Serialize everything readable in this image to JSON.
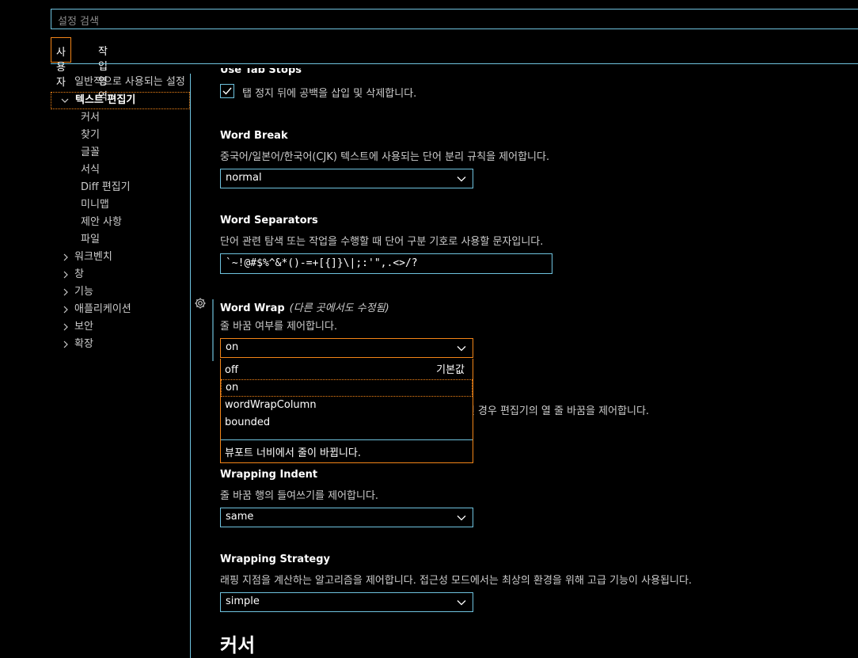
{
  "search": {
    "placeholder": "설정 검색"
  },
  "scope_tabs": {
    "user": "사용자",
    "workspace": "작업 영역"
  },
  "toc": {
    "general": "일반적으로 사용되는 설정",
    "text_editor": "텍스트 편집기",
    "editor_children": [
      "커서",
      "찾기",
      "글꼴",
      "서식",
      "Diff 편집기",
      "미니맵",
      "제안 사항",
      "파일"
    ],
    "groups": [
      "워크벤치",
      "창",
      "기능",
      "애플리케이션",
      "보안",
      "확장"
    ]
  },
  "settings": {
    "use_tab_stops": {
      "title": "Use Tab Stops",
      "checkbox_label": "탭 정지 뒤에 공백을 삽입 및 삭제합니다.",
      "checked": true
    },
    "word_break": {
      "title": "Word Break",
      "desc": "중국어/일본어/한국어(CJK) 텍스트에 사용되는 단어 분리 규칙을 제어합니다.",
      "value": "normal"
    },
    "word_separators": {
      "title": "Word Separators",
      "desc": "단어 관련 탐색 또는 작업을 수행할 때 단어 구분 기호로 사용할 문자입니다.",
      "value": "`~!@#$%^&*()-=+[{]}\\|;:'\",.<>/?"
    },
    "word_wrap": {
      "title": "Word Wrap",
      "modified_note": "(다른 곳에서도 수정됨)",
      "desc": "줄 바꿈 여부를 제어합니다.",
      "value": "on",
      "options": [
        {
          "label": "off",
          "tag": "기본값"
        },
        {
          "label": "on",
          "tag": ""
        },
        {
          "label": "wordWrapColumn",
          "tag": ""
        },
        {
          "label": "bounded",
          "tag": ""
        }
      ],
      "option_desc": "뷰포트 너비에서 줄이 바뀝니다."
    },
    "word_wrap_column_partial": "n'인 경우 편집기의 열 줄 바꿈을 제어합니다.",
    "wrapping_indent": {
      "title": "Wrapping Indent",
      "desc": "줄 바꿈 행의 들여쓰기를 제어합니다.",
      "value": "same"
    },
    "wrapping_strategy": {
      "title": "Wrapping Strategy",
      "desc": "래핑 지점을 계산하는 알고리즘을 제어합니다. 접근성 모드에서는 최상의 환경을 위해 고급 기능이 사용됩니다.",
      "value": "simple"
    }
  },
  "section_heading": "커서",
  "colors": {
    "accent_border": "#6fc3df",
    "focus": "#f38518",
    "background": "#000000"
  }
}
